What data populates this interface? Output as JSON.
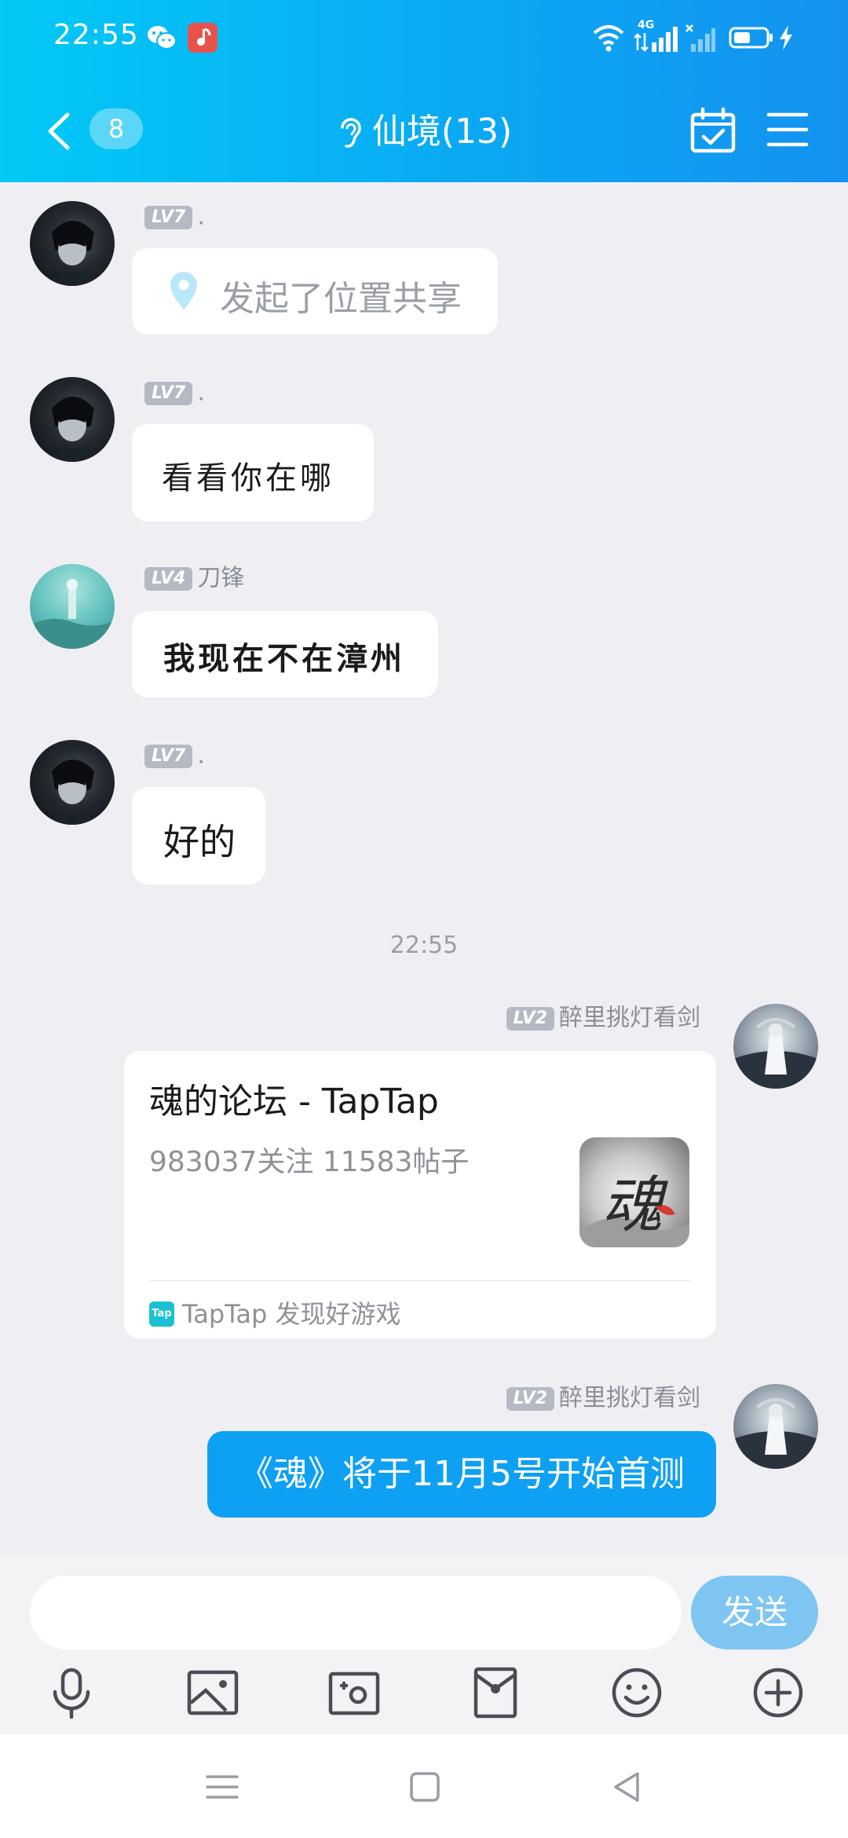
{
  "status_bar": {
    "time": "22:55",
    "icons": [
      "wechat-icon",
      "music-app-icon",
      "wifi-icon",
      "4g-signal-icon",
      "no-signal-icon",
      "battery-icon",
      "charging-icon"
    ],
    "network_label": "4G"
  },
  "header": {
    "back_badge": "8",
    "title": "仙境(13)",
    "icons": [
      "back-arrow-icon",
      "ear-icon",
      "calendar-check-icon",
      "menu-icon"
    ]
  },
  "messages": [
    {
      "sender_level": "LV7",
      "sender_name": ".",
      "type": "location",
      "text": "发起了位置共享"
    },
    {
      "sender_level": "LV7",
      "sender_name": ".",
      "type": "styled_text",
      "text": "看看你在哪"
    },
    {
      "sender_level": "LV4",
      "sender_name": "刀锋",
      "type": "styled_text",
      "text": "我现在不在漳州"
    },
    {
      "sender_level": "LV7",
      "sender_name": ".",
      "type": "styled_text",
      "text": "好的"
    }
  ],
  "time_separator": "22:55",
  "own_messages": [
    {
      "sender_level": "LV2",
      "sender_name": "醉里挑灯看剑",
      "type": "share_card",
      "card_title": "魂的论坛 - TapTap",
      "card_subtitle": "983037关注 11583帖子",
      "card_footer": "TapTap 发现好游戏",
      "card_footer_logo": "Tap",
      "thumb_glyph": "魂"
    },
    {
      "sender_level": "LV2",
      "sender_name": "醉里挑灯看剑",
      "type": "text",
      "text": "《魂》将于11月5号开始首测"
    }
  ],
  "composer": {
    "input_value": "",
    "send_label": "发送",
    "tools": [
      "microphone-icon",
      "image-icon",
      "camera-icon",
      "red-packet-icon",
      "emoji-icon",
      "plus-icon"
    ]
  },
  "colors": {
    "header_gradient_start": "#02c9f6",
    "header_gradient_end": "#1492f0",
    "own_bubble": "#0ea0f2",
    "send_button": "#7ec5f2",
    "level_badge": "#b4b9c4",
    "background": "#efeff3"
  }
}
